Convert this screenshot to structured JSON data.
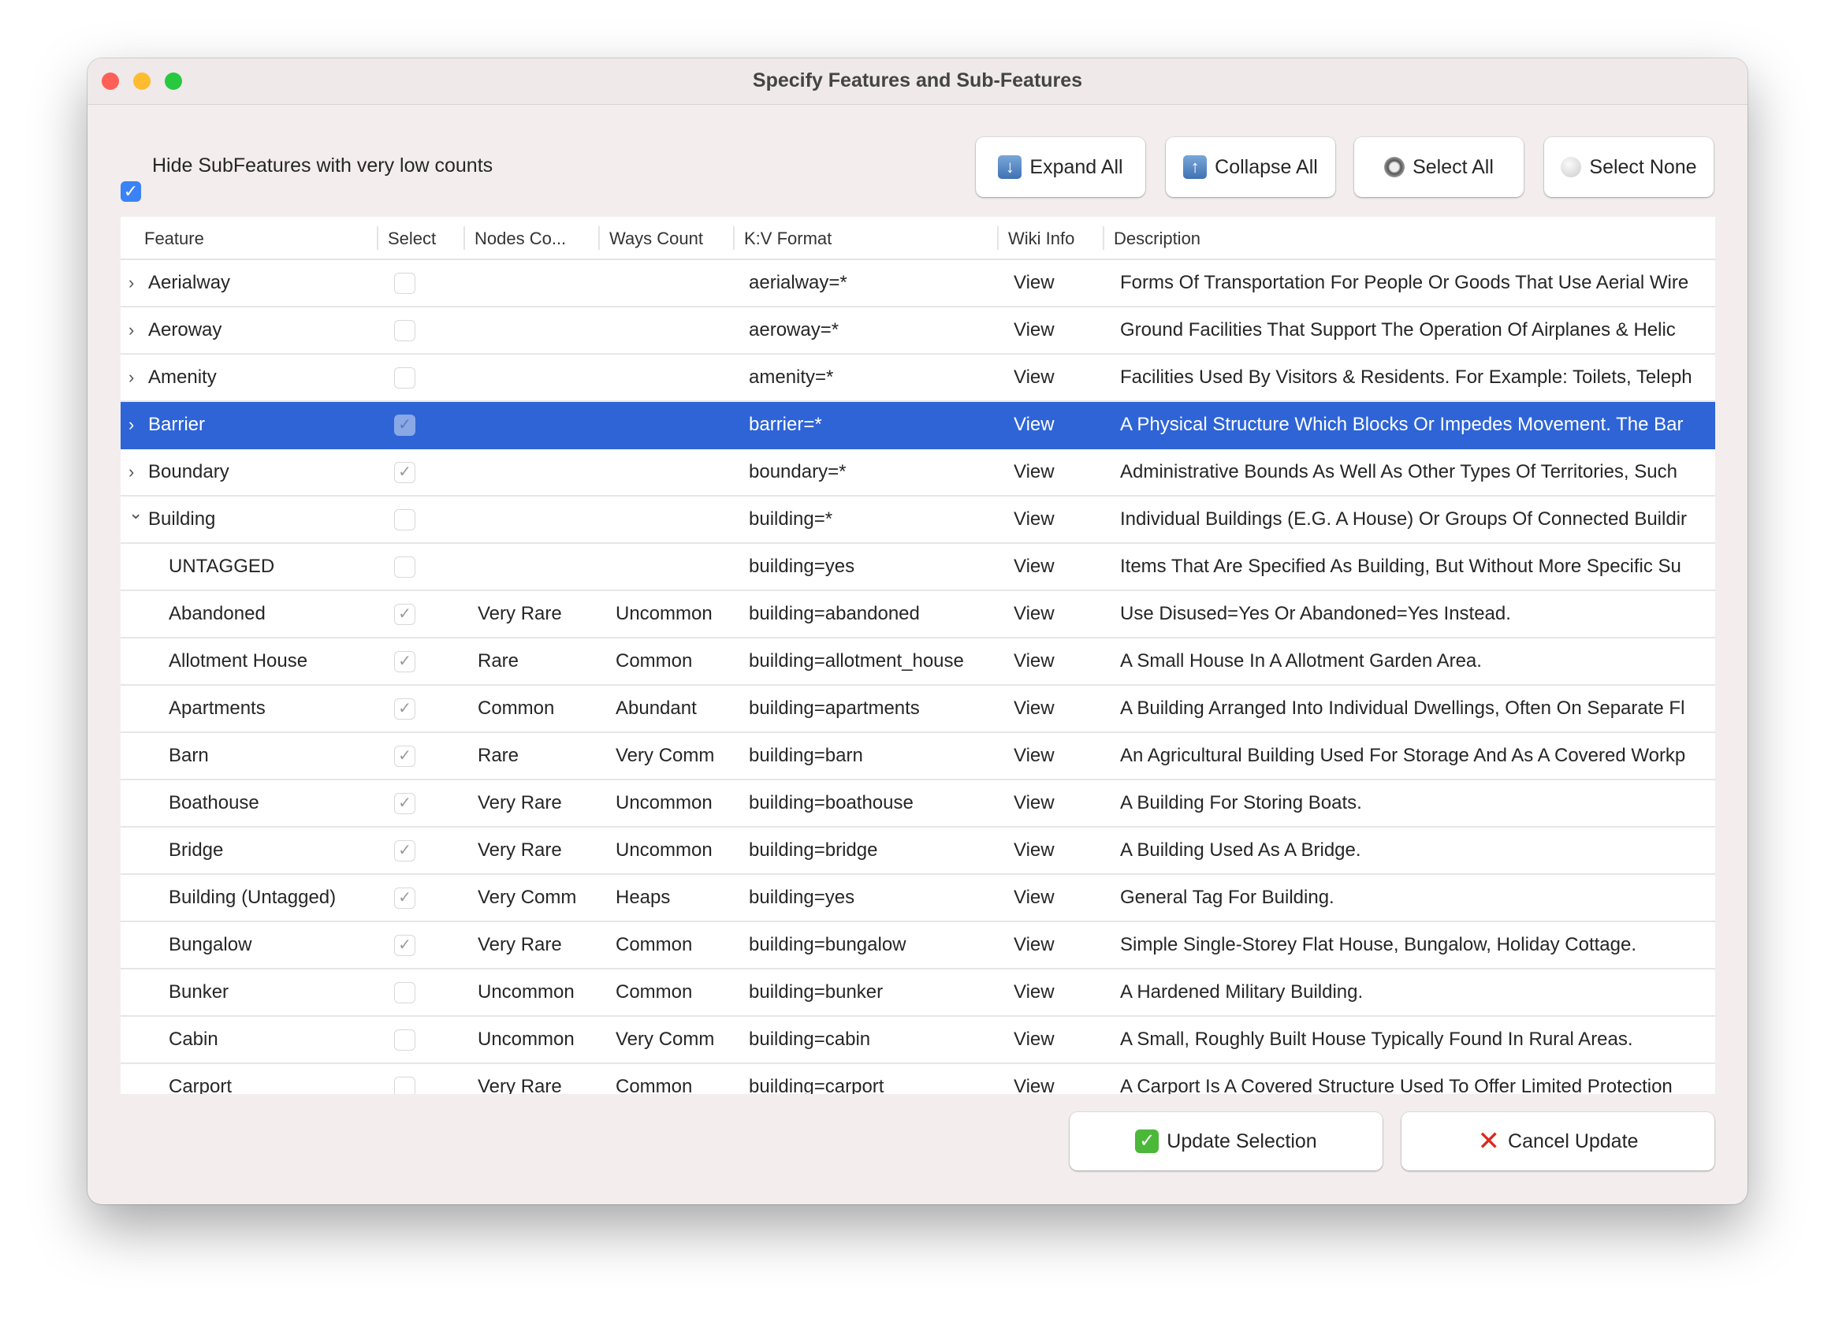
{
  "window": {
    "title": "Specify Features and Sub-Features"
  },
  "colors": {
    "selection": "#2e64d6",
    "checkbox_accent": "#3a82f7",
    "close": "#fe5f57",
    "minimize": "#febc2e",
    "zoom": "#28c840"
  },
  "options": {
    "hide_low_counts_label": "Hide SubFeatures with very low counts",
    "hide_low_counts_checked": true
  },
  "toolbar": {
    "expand_all": "Expand All",
    "collapse_all": "Collapse All",
    "select_all": "Select All",
    "select_none": "Select None"
  },
  "table": {
    "columns": [
      "Feature",
      "Select",
      "Nodes Co...",
      "Ways Count",
      "K:V Format",
      "Wiki Info",
      "Description"
    ],
    "rows": [
      {
        "feature": "Aerialway",
        "level": 0,
        "expanded": false,
        "checked": false,
        "nodes": "",
        "ways": "",
        "kv": "aerialway=*",
        "wiki": "View",
        "desc": "Forms Of Transportation For People Or Goods That Use Aerial Wire"
      },
      {
        "feature": "Aeroway",
        "level": 0,
        "expanded": false,
        "checked": false,
        "nodes": "",
        "ways": "",
        "kv": "aeroway=*",
        "wiki": "View",
        "desc": "Ground Facilities  That Support The Operation Of Airplanes & Helic"
      },
      {
        "feature": "Amenity",
        "level": 0,
        "expanded": false,
        "checked": false,
        "nodes": "",
        "ways": "",
        "kv": "amenity=*",
        "wiki": "View",
        "desc": "Facilities Used By Visitors & Residents. For Example: Toilets, Teleph"
      },
      {
        "feature": "Barrier",
        "level": 0,
        "expanded": false,
        "checked": true,
        "selected": true,
        "nodes": "",
        "ways": "",
        "kv": "barrier=*",
        "wiki": "View",
        "desc": "A Physical Structure Which Blocks Or Impedes Movement. The Bar"
      },
      {
        "feature": "Boundary",
        "level": 0,
        "expanded": false,
        "checked": true,
        "nodes": "",
        "ways": "",
        "kv": "boundary=*",
        "wiki": "View",
        "desc": "Administrative Bounds As Well As Other Types Of Territories, Such"
      },
      {
        "feature": "Building",
        "level": 0,
        "expanded": true,
        "checked": false,
        "nodes": "",
        "ways": "",
        "kv": "building=*",
        "wiki": "View",
        "desc": "Individual Buildings (E.G. A House) Or Groups Of Connected Buildir"
      },
      {
        "feature": "UNTAGGED",
        "level": 1,
        "checked": false,
        "nodes": "",
        "ways": "",
        "kv": "building=yes",
        "wiki": "View",
        "desc": "Items That Are Specified As Building, But Without More Specific Su"
      },
      {
        "feature": "Abandoned",
        "level": 1,
        "checked": true,
        "nodes": "Very Rare",
        "ways": "Uncommon",
        "kv": "building=abandoned",
        "wiki": "View",
        "desc": "Use Disused=Yes Or Abandoned=Yes Instead."
      },
      {
        "feature": "Allotment House",
        "level": 1,
        "checked": true,
        "nodes": "Rare",
        "ways": "Common",
        "kv": "building=allotment_house",
        "wiki": "View",
        "desc": "A Small House In A Allotment Garden Area."
      },
      {
        "feature": "Apartments",
        "level": 1,
        "checked": true,
        "nodes": "Common",
        "ways": "Abundant",
        "kv": "building=apartments",
        "wiki": "View",
        "desc": "A Building Arranged Into Individual Dwellings, Often On Separate Fl"
      },
      {
        "feature": "Barn",
        "level": 1,
        "checked": true,
        "nodes": "Rare",
        "ways": "Very Comm",
        "kv": "building=barn",
        "wiki": "View",
        "desc": "An Agricultural Building Used For Storage And As A Covered Workp"
      },
      {
        "feature": "Boathouse",
        "level": 1,
        "checked": true,
        "nodes": "Very Rare",
        "ways": "Uncommon",
        "kv": "building=boathouse",
        "wiki": "View",
        "desc": "A Building For Storing Boats."
      },
      {
        "feature": "Bridge",
        "level": 1,
        "checked": true,
        "nodes": "Very Rare",
        "ways": "Uncommon",
        "kv": "building=bridge",
        "wiki": "View",
        "desc": "A Building Used As A Bridge."
      },
      {
        "feature": "Building (Untagged)",
        "level": 1,
        "checked": true,
        "nodes": "Very Comm",
        "ways": "Heaps",
        "kv": "building=yes",
        "wiki": "View",
        "desc": "General Tag For Building."
      },
      {
        "feature": "Bungalow",
        "level": 1,
        "checked": true,
        "nodes": "Very Rare",
        "ways": "Common",
        "kv": "building=bungalow",
        "wiki": "View",
        "desc": "Simple Single-Storey Flat House, Bungalow, Holiday Cottage."
      },
      {
        "feature": "Bunker",
        "level": 1,
        "checked": false,
        "nodes": "Uncommon",
        "ways": "Common",
        "kv": "building=bunker",
        "wiki": "View",
        "desc": "A Hardened Military Building."
      },
      {
        "feature": "Cabin",
        "level": 1,
        "checked": false,
        "nodes": "Uncommon",
        "ways": "Very Comm",
        "kv": "building=cabin",
        "wiki": "View",
        "desc": "A Small, Roughly Built House Typically Found In Rural Areas."
      },
      {
        "feature": "Carport",
        "level": 1,
        "checked": false,
        "nodes": "Very Rare",
        "ways": "Common",
        "kv": "building=carport",
        "wiki": "View",
        "desc": "A Carport Is A Covered Structure Used To Offer Limited Protection"
      }
    ]
  },
  "footer": {
    "update": "Update Selection",
    "cancel": "Cancel Update"
  }
}
